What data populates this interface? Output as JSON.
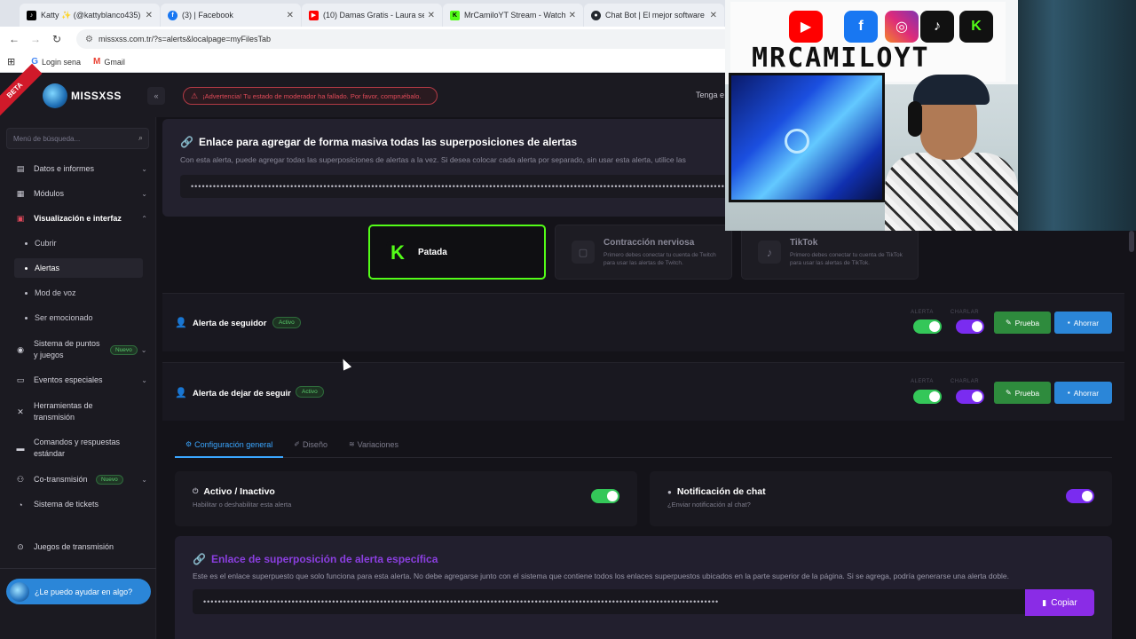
{
  "browser": {
    "tabs": [
      {
        "label": "Katty ✨ (@kattyblanco435) | T",
        "icon": "tiktok-icon",
        "color": "#000000"
      },
      {
        "label": "(3) | Facebook",
        "icon": "facebook-icon",
        "color": "#1877f2"
      },
      {
        "label": "(10) Damas Gratis - Laura se to",
        "icon": "youtube-icon",
        "color": "#ff0000"
      },
      {
        "label": "MrCamiloYT Stream - Watch Li",
        "icon": "kick-icon",
        "color": "#53fc18"
      },
      {
        "label": "Chat Bot | El mejor software par",
        "icon": "github-icon",
        "color": "#24292f"
      }
    ],
    "url": "missxss.com.tr/?s=alerts&localpage=myFilesTab",
    "bookmarks": [
      {
        "label": "Login sena",
        "icon": "google-icon"
      },
      {
        "label": "Gmail",
        "icon": "gmail-icon"
      }
    ]
  },
  "app": {
    "beta": "BETA",
    "logo_text": "MISSXSS",
    "warning": "¡Advertencia! Tu estado de moderador ha fallado. Por favor, compruébalo.",
    "topright_text": "Tenga e"
  },
  "sidebar": {
    "search_placeholder": "Menú de búsqueda...",
    "items": [
      {
        "label": "Datos e informes",
        "icon": "chart-icon"
      },
      {
        "label": "Módulos",
        "icon": "grid-icon"
      },
      {
        "label": "Visualización e interfaz",
        "icon": "layout-icon"
      },
      {
        "label": "Sistema de puntos y juegos",
        "icon": "coin-icon",
        "badge": "Nuevo"
      },
      {
        "label": "Eventos especiales",
        "icon": "calendar-icon"
      },
      {
        "label": "Herramientas de transmisión",
        "icon": "tools-icon"
      },
      {
        "label": "Comandos y respuestas estándar",
        "icon": "terminal-icon"
      },
      {
        "label": "Co-transmisión",
        "icon": "users-icon",
        "badge": "Nuevo"
      },
      {
        "label": "Sistema de tickets",
        "icon": "ticket-icon"
      },
      {
        "label": "Juegos de transmisión",
        "icon": "gamepad-icon"
      }
    ],
    "subitems": [
      "Cubrir",
      "Alertas",
      "Mod de voz",
      "Ser emocionado"
    ],
    "help": "¿Le puedo ayudar en algo?"
  },
  "bulk": {
    "title": "Enlace para agregar de forma masiva todas las superposiciones de alertas",
    "description": "Con esta alerta, puede agregar todas las superposiciones de alertas a la vez. Si desea colocar cada alerta por separado, sin usar esta alerta, utilice las",
    "masked": "••••••••••••••••••••••••••••••••••••••••••••••••••••••••••••••••••••••••••••••••••••••••••••••••••••••••••••••••••••••••••••••••••••••••••••••••••••••••••••••"
  },
  "platforms": [
    {
      "name": "Patada",
      "note": "",
      "selected": true
    },
    {
      "name": "Contracción nerviosa",
      "note": "Primero debes conectar tu cuenta de Twitch para usar las alertas de Twitch."
    },
    {
      "name": "TikTok",
      "note": "Primero debes conectar tu cuenta de TikTok para usar las alertas de TikTok."
    }
  ],
  "alerts": [
    {
      "title": "Alerta de seguidor",
      "status": "Activo",
      "label_alert": "ALERTA",
      "label_chat": "CHARLAR",
      "test": "Prueba",
      "save": "Ahorrar",
      "alert_on": true,
      "chat_on": true
    },
    {
      "title": "Alerta de dejar de seguir",
      "status": "Activo",
      "label_alert": "ALERTA",
      "label_chat": "CHARLAR",
      "test": "Prueba",
      "save": "Ahorrar",
      "alert_on": true,
      "chat_on": true
    }
  ],
  "config_tabs": [
    "Configuración general",
    "Diseño",
    "Variaciones"
  ],
  "settings": [
    {
      "title": "Activo / Inactivo",
      "subtitle": "Habilitar o deshabilitar esta alerta",
      "on": true
    },
    {
      "title": "Notificación de chat",
      "subtitle": "¿Enviar notificación al chat?",
      "on": true
    }
  ],
  "specific": {
    "title": "Enlace de superposición de alerta específica",
    "description": "Este es el enlace superpuesto que solo funciona para esta alerta. No debe agregarse junto con el sistema que contiene todos los enlaces superpuestos ubicados en la parte superior de la página. Si se agrega, podría generarse una alerta doble.",
    "masked": "••••••••••••••••••••••••••••••••••••••••••••••••••••••••••••••••••••••••••••••••••••••••••••••••••••••••••••••••••••••••••••••••••••••••••••",
    "copy": "Copiar"
  },
  "webcam": {
    "wall_text": "MRCAMILOYT",
    "social_icons": [
      "youtube-icon",
      "facebook-icon",
      "instagram-icon",
      "tiktok-icon",
      "kick-icon"
    ]
  },
  "colors": {
    "kick_green": "#53fc18",
    "accent_purple": "#8a2ce6",
    "accent_blue": "#2b86d8",
    "toggle_green": "#34c759",
    "toggle_purple": "#7a2cf0",
    "warning_red": "#e04a58"
  }
}
